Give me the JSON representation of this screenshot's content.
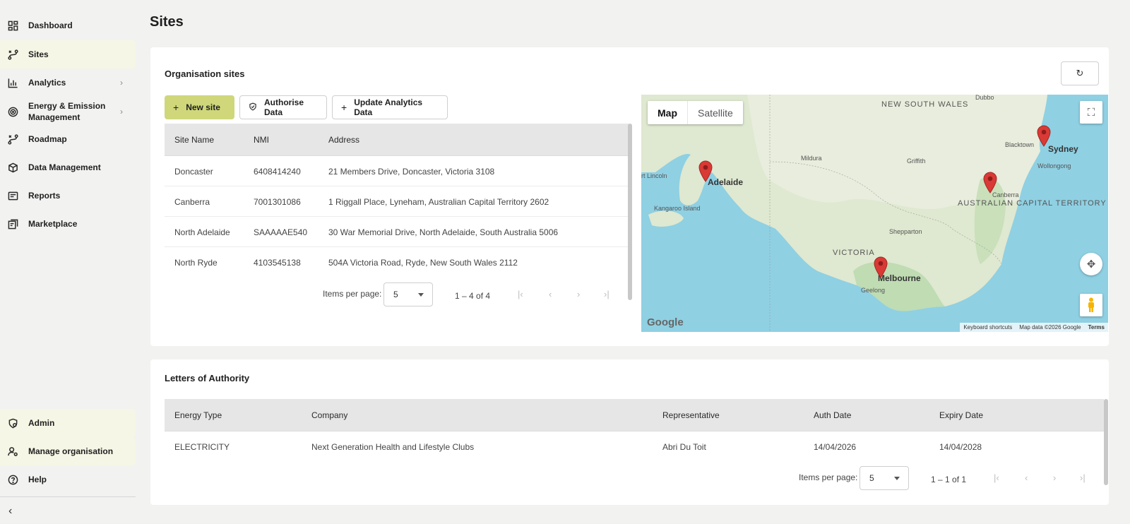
{
  "sidebar": {
    "items": [
      {
        "label": "Dashboard"
      },
      {
        "label": "Sites"
      },
      {
        "label": "Analytics"
      },
      {
        "label": "Energy & Emission Management"
      },
      {
        "label": "Roadmap"
      },
      {
        "label": "Data Management"
      },
      {
        "label": "Reports"
      },
      {
        "label": "Marketplace"
      }
    ],
    "bottom_items": [
      {
        "label": "Admin"
      },
      {
        "label": "Manage organisation"
      },
      {
        "label": "Help"
      }
    ]
  },
  "page": {
    "title": "Sites"
  },
  "org_sites": {
    "title": "Organisation sites",
    "buttons": {
      "new_site": "New site",
      "authorise": "Authorise Data",
      "update_analytics": "Update Analytics Data"
    },
    "columns": [
      "Site Name",
      "NMI",
      "Address"
    ],
    "rows": [
      {
        "site": "Doncaster",
        "nmi": "6408414240",
        "address": "21 Members Drive, Doncaster, Victoria 3108"
      },
      {
        "site": "Canberra",
        "nmi": "7001301086",
        "address": "1 Riggall Place, Lyneham, Australian Capital Territory 2602"
      },
      {
        "site": "North Adelaide",
        "nmi": "SAAAAAE540",
        "address": "30 War Memorial Drive, North Adelaide, South Australia 5006"
      },
      {
        "site": "North Ryde",
        "nmi": "4103545138",
        "address": "504A Victoria Road, Ryde, New South Wales 2112"
      }
    ],
    "pager": {
      "label": "Items per page:",
      "value": "5",
      "range": "1 – 4 of 4"
    }
  },
  "map": {
    "toggle_map": "Map",
    "toggle_satellite": "Satellite",
    "labels": {
      "nsw": "NEW SOUTH WALES",
      "victoria": "VICTORIA",
      "act": "AUSTRALIAN CAPITAL TERRITORY",
      "adelaide": "Adelaide",
      "melbourne": "Melbourne",
      "sydney": "Sydney",
      "canberra": "Canberra",
      "dubbo": "Dubbo",
      "mildura": "Mildura",
      "griffith": "Griffith",
      "blacktown": "Blacktown",
      "wollongong": "Wollongong",
      "shepparton": "Shepparton",
      "geelong": "Geelong",
      "kangaroo": "Kangaroo Island",
      "lincoln": "rt Lincoln"
    },
    "google": "Google",
    "footer": {
      "shortcuts": "Keyboard shortcuts",
      "mapdata": "Map data ©2026 Google",
      "terms": "Terms"
    }
  },
  "loa": {
    "title": "Letters of Authority",
    "columns": [
      "Energy Type",
      "Company",
      "Representative",
      "Auth Date",
      "Expiry Date"
    ],
    "rows": [
      {
        "type": "ELECTRICITY",
        "company": "Next Generation Health and Lifestyle Clubs",
        "rep": "Abri Du Toit",
        "auth": "14/04/2026",
        "expiry": "14/04/2028"
      }
    ],
    "pager": {
      "label": "Items per page:",
      "value": "5",
      "range": "1 – 1 of 1"
    }
  },
  "colors": {
    "accent": "#cfd77a",
    "active_bg": "#f6f6e6",
    "pin": "#d93a35"
  }
}
